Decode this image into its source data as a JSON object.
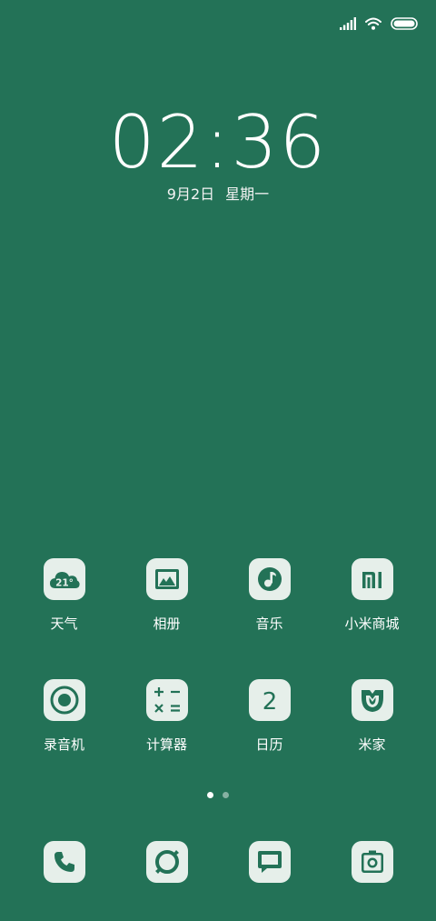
{
  "colors": {
    "background": "#237257",
    "icon_tile": "#e6efea",
    "icon_glyph": "#237257"
  },
  "status_bar": {
    "icons": [
      "signal-icon",
      "wifi-icon",
      "battery-icon"
    ]
  },
  "lockscreen": {
    "time": "02:36",
    "date": "9月2日",
    "weekday": "星期一"
  },
  "apps_row1": [
    {
      "label": "天气",
      "icon": "weather-icon",
      "icon_text": "21°"
    },
    {
      "label": "相册",
      "icon": "gallery-icon"
    },
    {
      "label": "音乐",
      "icon": "music-icon"
    },
    {
      "label": "小米商城",
      "icon": "mi-store-icon",
      "icon_text": "mi"
    }
  ],
  "apps_row2": [
    {
      "label": "录音机",
      "icon": "recorder-icon"
    },
    {
      "label": "计算器",
      "icon": "calculator-icon"
    },
    {
      "label": "日历",
      "icon": "calendar-icon",
      "icon_text": "2"
    },
    {
      "label": "米家",
      "icon": "mijia-icon"
    }
  ],
  "page_indicator": {
    "pages": 2,
    "current": 1
  },
  "dock": [
    {
      "icon": "phone-icon"
    },
    {
      "icon": "browser-icon"
    },
    {
      "icon": "messages-icon"
    },
    {
      "icon": "camera-icon"
    }
  ]
}
